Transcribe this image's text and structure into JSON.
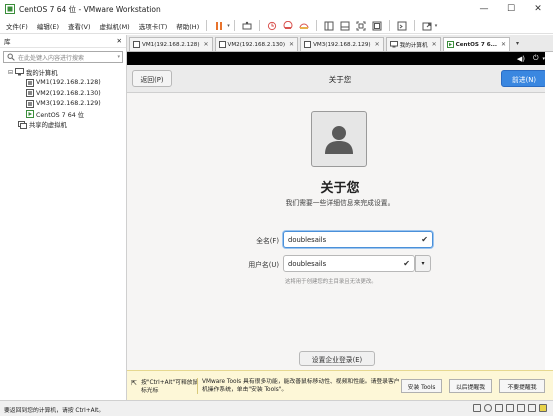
{
  "window": {
    "title": "CentOS 7 64 位 - VMware Workstation",
    "controls": [
      "—",
      "☐",
      "✕"
    ]
  },
  "menu": {
    "items": [
      "文件(F)",
      "编辑(E)",
      "查看(V)",
      "虚拟机(M)",
      "选项卡(T)",
      "帮助(H)"
    ]
  },
  "toolbar": {
    "icons": [
      "pause-icon",
      "send-keys-icon",
      "snapshot-icon",
      "revert-snapshot-icon",
      "manage-snapshot-icon",
      "sidebar-view-icon",
      "thumbnail-view-icon",
      "fullscreen-icon",
      "unity-icon",
      "console-icon",
      "stretch-icon"
    ]
  },
  "sidebar": {
    "header": "库",
    "close": "✕",
    "search_placeholder": "在此处键入内容进行搜索",
    "tree": [
      {
        "label": "我的计算机",
        "level": 0,
        "icon": "computer-icon"
      },
      {
        "label": "VM1(192.168.2.128)",
        "level": 1,
        "icon": "vm-icon"
      },
      {
        "label": "VM2(192.168.2.130)",
        "level": 1,
        "icon": "vm-icon"
      },
      {
        "label": "VM3(192.168.2.129)",
        "level": 1,
        "icon": "vm-icon"
      },
      {
        "label": "CentOS 7 64 位",
        "level": 1,
        "icon": "vm-running-icon"
      },
      {
        "label": "共享的虚拟机",
        "level": 0,
        "icon": "shared-icon"
      }
    ]
  },
  "tabs": [
    {
      "label": "VM1(192.168.2.128)",
      "active": false
    },
    {
      "label": "VM2(192.168.2.130)",
      "active": false
    },
    {
      "label": "VM3(192.168.2.129)",
      "active": false
    },
    {
      "label": "我的计算机",
      "active": false
    },
    {
      "label": "CentOS 7 6...",
      "active": true
    }
  ],
  "guest": {
    "header": {
      "back": "返回(P)",
      "title": "关于您",
      "next": "前进(N)"
    },
    "about_title": "关于您",
    "about_subtitle": "我们需要一些详细信息来完成设置。",
    "fullname_label": "全名(F)",
    "fullname_value": "doublesails",
    "username_label": "用户名(U)",
    "username_value": "doublesails",
    "hint": "这将用于创建您的主目录且无法更改。",
    "enterprise_button": "设置企业登录(E)"
  },
  "notification": {
    "tip": "按\"Ctrl+Alt\"可释放鼠标光标",
    "message": "VMware Tools 具有很多功能，能改善鼠标移动性、视频和性能。请登录客户机操作系统，单击\"安装 Tools\"。",
    "install_button": "安装 Tools",
    "remind_button": "以后提醒我",
    "never_button": "不要提醒我"
  },
  "status": {
    "text": "要返回到您的计算机，请按 Ctrl+Alt。"
  },
  "colors": {
    "accent": "#3a87e0",
    "notif_bg": "#fdf7d7",
    "toolbar_orange": "#e8732c"
  }
}
